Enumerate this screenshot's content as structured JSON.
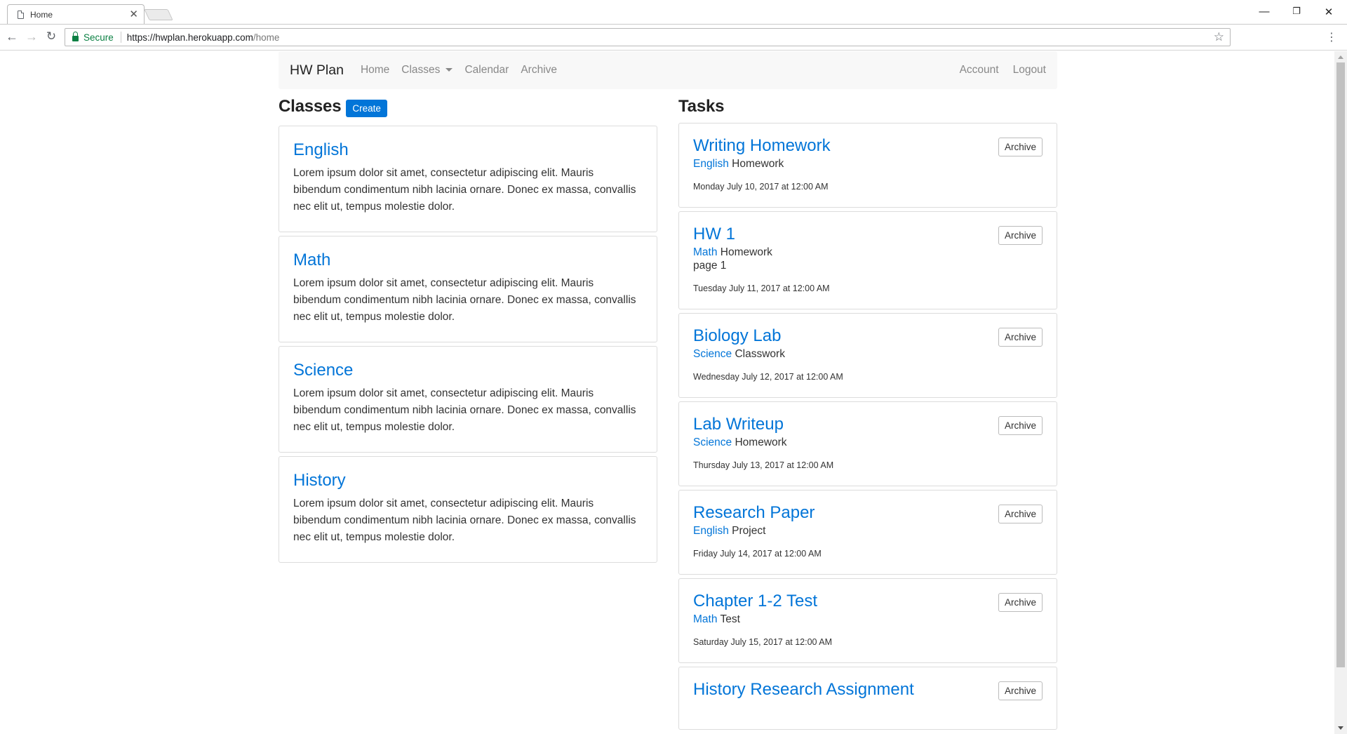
{
  "browser": {
    "tab_title": "Home",
    "secure_label": "Secure",
    "url_host": "https://hwplan.herokuapp.com",
    "url_path": "/home"
  },
  "nav": {
    "brand": "HW Plan",
    "home": "Home",
    "classes": "Classes",
    "calendar": "Calendar",
    "archive": "Archive",
    "account": "Account",
    "logout": "Logout"
  },
  "classes": {
    "heading": "Classes",
    "create_label": "Create",
    "items": [
      {
        "name": "English",
        "description": "Lorem ipsum dolor sit amet, consectetur adipiscing elit. Mauris bibendum condimentum nibh lacinia ornare. Donec ex massa, convallis nec elit ut, tempus molestie dolor."
      },
      {
        "name": "Math",
        "description": "Lorem ipsum dolor sit amet, consectetur adipiscing elit. Mauris bibendum condimentum nibh lacinia ornare. Donec ex massa, convallis nec elit ut, tempus molestie dolor."
      },
      {
        "name": "Science",
        "description": "Lorem ipsum dolor sit amet, consectetur adipiscing elit. Mauris bibendum condimentum nibh lacinia ornare. Donec ex massa, convallis nec elit ut, tempus molestie dolor."
      },
      {
        "name": "History",
        "description": "Lorem ipsum dolor sit amet, consectetur adipiscing elit. Mauris bibendum condimentum nibh lacinia ornare. Donec ex massa, convallis nec elit ut, tempus molestie dolor."
      }
    ]
  },
  "tasks": {
    "heading": "Tasks",
    "archive_label": "Archive",
    "items": [
      {
        "title": "Writing Homework",
        "class": "English",
        "type": "Homework",
        "note": "",
        "date": "Monday July 10, 2017 at 12:00 AM"
      },
      {
        "title": "HW 1",
        "class": "Math",
        "type": "Homework",
        "note": "page 1",
        "date": "Tuesday July 11, 2017 at 12:00 AM"
      },
      {
        "title": "Biology Lab",
        "class": "Science",
        "type": "Classwork",
        "note": "",
        "date": "Wednesday July 12, 2017 at 12:00 AM"
      },
      {
        "title": "Lab Writeup",
        "class": "Science",
        "type": "Homework",
        "note": "",
        "date": "Thursday July 13, 2017 at 12:00 AM"
      },
      {
        "title": "Research Paper",
        "class": "English",
        "type": "Project",
        "note": "",
        "date": "Friday July 14, 2017 at 12:00 AM"
      },
      {
        "title": "Chapter 1-2 Test",
        "class": "Math",
        "type": "Test",
        "note": "",
        "date": "Saturday July 15, 2017 at 12:00 AM"
      },
      {
        "title": "History Research Assignment",
        "class": "",
        "type": "",
        "note": "",
        "date": ""
      }
    ]
  }
}
